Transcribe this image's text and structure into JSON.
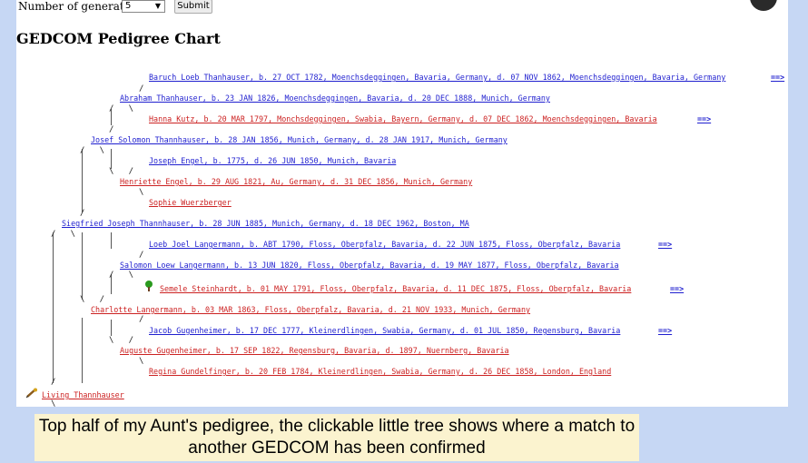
{
  "form": {
    "generations_label": "Number of generations",
    "generations_value": "5",
    "submit_label": "Submit"
  },
  "title": "GEDCOM Pedigree Chart",
  "pedigree": {
    "p1": "Baruch Loeb Thanhauser, b. 27 OCT 1782, Moenchsdeggingen, Bavaria, Germany, d. 07 NOV 1862, Moenchsdeggingen, Bavaria, Germany",
    "p2": "Abraham Thanhauser, b. 23 JAN 1826, Moenchsdeggingen, Bavaria, d. 20 DEC 1888, Munich, Germany",
    "p3": "Hanna Kutz, b. 20 MAR 1797, Monchsdeggingen, Swabia, Bayern, Germany, d. 07 DEC 1862, Moenchsdeggingen, Bavaria",
    "p4": "Josef Solomon Thannhauser, b. 28 JAN 1856, Munich, Germany, d. 28 JAN 1917, Munich, Germany",
    "p5": "Joseph Engel, b. 1775, d. 26 JUN 1850, Munich, Bavaria",
    "p6": "Henriette Engel, b. 29 AUG 1821, Au, Germany, d. 31 DEC 1856, Munich, Germany",
    "p7": "Sophie Wuerzberger",
    "p8": "Siegfried Joseph Thannhauser, b. 28 JUN 1885, Munich, Germany, d. 18 DEC 1962, Boston, MA",
    "p9": "Loeb Joel Langermann, b. ABT 1790, Floss, Oberpfalz, Bavaria, d. 22 JUN 1875, Floss, Oberpfalz, Bavaria",
    "p10": "Salomon Loew Langermann, b. 13 JUN 1820, Floss, Oberpfalz, Bavaria, d. 19 MAY 1877, Floss, Oberpfalz, Bavaria",
    "p11": "Semele Steinhardt, b. 01 MAY 1791, Floss, Oberpfalz, Bavaria, d. 11 DEC 1875, Floss, Oberpfalz, Bavaria",
    "p12": "Charlotte Langermann, b. 03 MAR 1863, Floss, Oberpfalz, Bavaria, d. 21 NOV 1933, Munich, Germany",
    "p13": "Jacob Gugenheimer, b. 17 DEC 1777, Kleinerdlingen, Swabia, Germany, d. 01 JUL 1850, Regensburg, Bavaria",
    "p14": "Auguste Gugenheimer, b. 17 SEP 1822, Regensburg, Bavaria, d. 1897, Nuernberg, Bavaria",
    "p15": "Regina Gundelfinger, b. 20 FEB 1784, Kleinerdlingen, Swabia, Germany, d. 26 DEC 1858, London, England",
    "root": "Living Thannhauser",
    "more_arrow": "==>"
  },
  "caption": "Top half of my Aunt's pedigree, the clickable little tree shows where a match to another GEDCOM has been confirmed"
}
